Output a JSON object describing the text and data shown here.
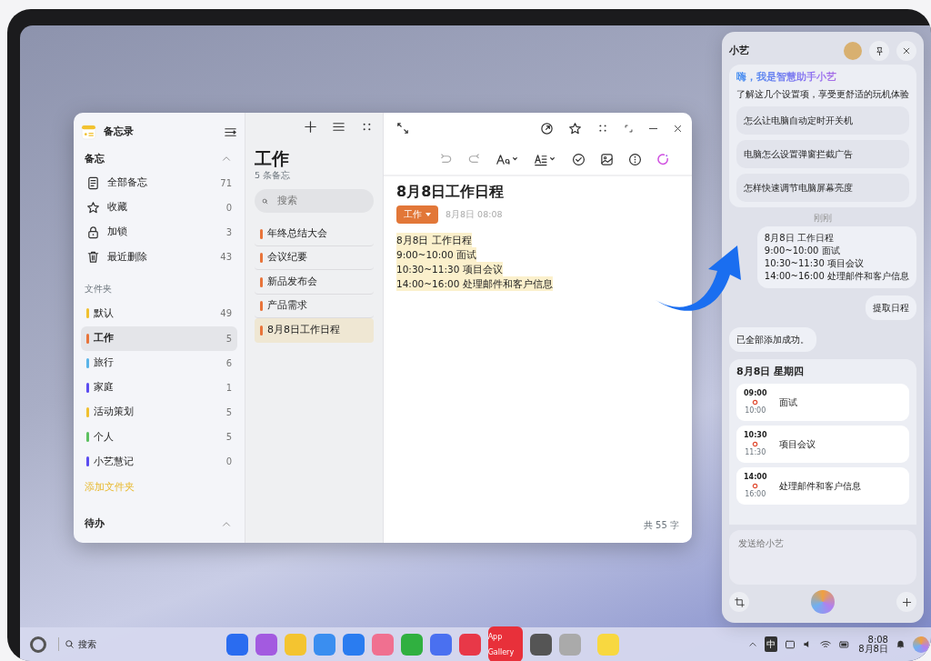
{
  "notes_window": {
    "app_title": "备忘录",
    "section": "备忘",
    "items": [
      {
        "label": "全部备忘",
        "count": "71"
      },
      {
        "label": "收藏",
        "count": "0"
      },
      {
        "label": "加锁",
        "count": "3"
      },
      {
        "label": "最近删除",
        "count": "43"
      }
    ],
    "folders_label": "文件夹",
    "folders": [
      {
        "label": "默认",
        "count": "49",
        "color": "#f0c030",
        "selected": false
      },
      {
        "label": "工作",
        "count": "5",
        "color": "#e8743a",
        "selected": true
      },
      {
        "label": "旅行",
        "count": "6",
        "color": "#5ab4e8",
        "selected": false
      },
      {
        "label": "家庭",
        "count": "1",
        "color": "#5b4cf0",
        "selected": false
      },
      {
        "label": "活动策划",
        "count": "5",
        "color": "#f0c030",
        "selected": false
      },
      {
        "label": "个人",
        "count": "5",
        "color": "#5cc060",
        "selected": false
      },
      {
        "label": "小艺慧记",
        "count": "0",
        "color": "#5b4cf0",
        "selected": false
      }
    ],
    "add_folder": "添加文件夹",
    "todo_section": "待办",
    "note_list": {
      "title": "工作",
      "count": "5 条备忘",
      "search_placeholder": "搜索",
      "notes": [
        {
          "title": "年终总结大会",
          "selected": false
        },
        {
          "title": "会议纪要",
          "selected": false
        },
        {
          "title": "新品发布会",
          "selected": false
        },
        {
          "title": "产品需求",
          "selected": false
        },
        {
          "title": "8月8日工作日程",
          "selected": true
        }
      ]
    },
    "editor": {
      "title": "8月8日工作日程",
      "tag": "工作",
      "date": "8月8日 08:08",
      "lines": [
        "8月8日 工作日程",
        "9:00~10:00 面试",
        "10:30~11:30 项目会议",
        "14:00~16:00 处理邮件和客户信息"
      ],
      "word_count": "共 55 字"
    }
  },
  "assistant": {
    "title": "小艺",
    "greeting": "嗨，我是智慧助手小艺",
    "subtitle": "了解这几个设置项，享受更舒适的玩机体验",
    "suggestions": [
      "怎么让电脑自动定时开关机",
      "电脑怎么设置弹窗拦截广告",
      "怎样快速调节电脑屏幕亮度"
    ],
    "timestamp": "刚刚",
    "user_message": [
      "8月8日 工作日程",
      "9:00~10:00 面试",
      "10:30~11:30 项目会议",
      "14:00~16:00 处理邮件和客户信息"
    ],
    "user_command": "提取日程",
    "reply": "已全部添加成功。",
    "schedule": {
      "date": "8月8日 星期四",
      "events": [
        {
          "start": "09:00",
          "title": "面试",
          "end": "10:00"
        },
        {
          "start": "10:30",
          "title": "项目会议",
          "end": "11:30"
        },
        {
          "start": "14:00",
          "title": "处理邮件和客户信息",
          "end": "16:00"
        }
      ]
    },
    "input_placeholder": "发送给小艺"
  },
  "taskbar": {
    "search": "搜索",
    "app_gallery_label": "App Gallery",
    "ime": "中",
    "time": "8:08",
    "date": "8月8日"
  }
}
